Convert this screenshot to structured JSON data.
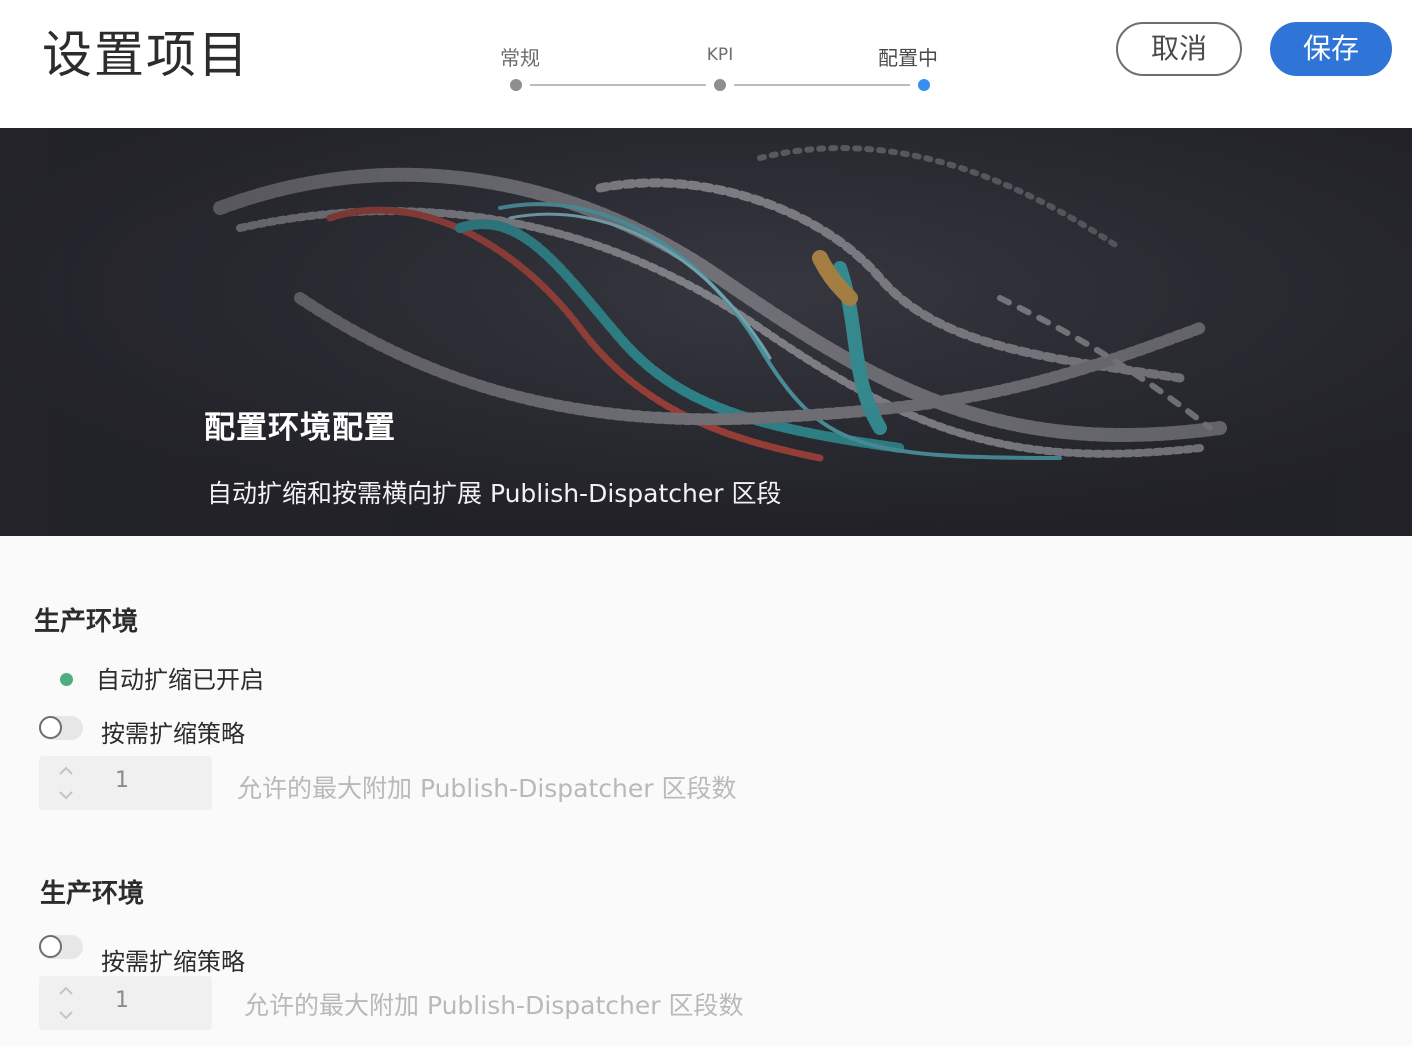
{
  "header": {
    "title": "设置项目",
    "steps": [
      {
        "label": "常规",
        "active": false
      },
      {
        "label": "KPI",
        "active": false
      },
      {
        "label": "配置中",
        "active": true
      }
    ],
    "cancel_label": "取消",
    "save_label": "保存"
  },
  "hero": {
    "title": "配置环境配置",
    "subtitle": "自动扩缩和按需横向扩展 Publish-Dispatcher 区段"
  },
  "sections": [
    {
      "title": "生产环境",
      "status_text": "自动扩缩已开启",
      "toggle_label": "按需扩缩策略",
      "toggle_on": false,
      "stepper_value": "1",
      "field_label": "允许的最大附加 Publish-Dispatcher 区段数"
    },
    {
      "title": "生产环境",
      "toggle_label": "按需扩缩策略",
      "toggle_on": false,
      "stepper_value": "1",
      "field_label": "允许的最大附加 Publish-Dispatcher 区段数"
    }
  ],
  "colors": {
    "accent": "#2f74d7",
    "step_active": "#378ef0",
    "status_ok": "#4fae7f",
    "hero_bg": "#26262d"
  },
  "icons": {
    "status": "green-dot-icon",
    "stepper": "chevron-up-down-icon"
  }
}
